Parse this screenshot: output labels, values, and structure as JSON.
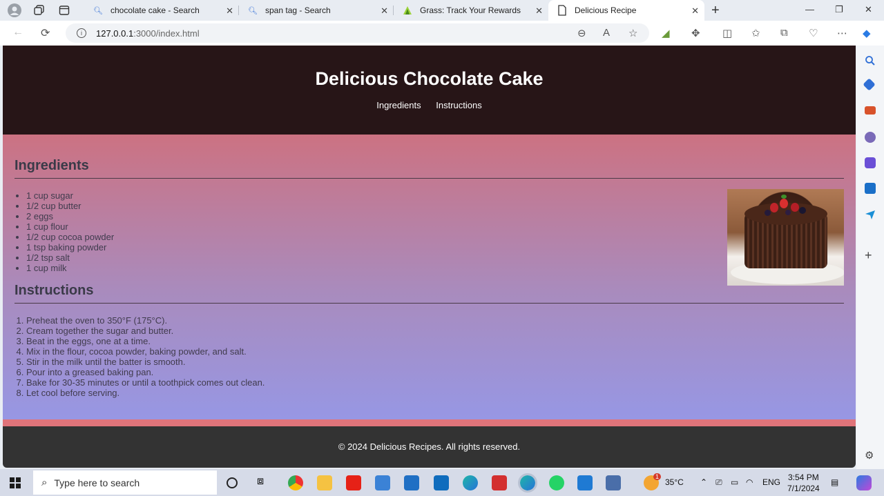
{
  "browser": {
    "tabs": [
      {
        "title": "chocolate cake - Search",
        "active": false
      },
      {
        "title": "span tag - Search",
        "active": false
      },
      {
        "title": "Grass: Track Your Rewards",
        "active": false
      },
      {
        "title": "Delicious Recipe",
        "active": true
      }
    ],
    "url_host": "127.0.0.1",
    "url_path": ":3000/index.html"
  },
  "page": {
    "title": "Delicious Chocolate Cake",
    "nav": [
      "Ingredients",
      "Instructions"
    ],
    "ingredients_heading": "Ingredients",
    "ingredients": [
      "1 cup sugar",
      "1/2 cup butter",
      "2 eggs",
      "1 cup flour",
      "1/2 cup cocoa powder",
      "1 tsp baking powder",
      "1/2 tsp salt",
      "1 cup milk"
    ],
    "instructions_heading": "Instructions",
    "instructions": [
      "Preheat the oven to 350°F (175°C).",
      "Cream together the sugar and butter.",
      "Beat in the eggs, one at a time.",
      "Mix in the flour, cocoa powder, baking powder, and salt.",
      "Stir in the milk until the batter is smooth.",
      "Pour into a greased baking pan.",
      "Bake for 30-35 minutes or until a toothpick comes out clean.",
      "Let cool before serving."
    ],
    "footer": "© 2024 Delicious Recipes. All rights reserved.",
    "colors": {
      "header_bg": "#271517",
      "footer_bg": "#333333",
      "gradient_top": "#cc7282",
      "gradient_bottom": "#9797e4",
      "accent_strip": "#e0747a"
    }
  },
  "taskbar": {
    "search_placeholder": "Type here to search",
    "weather": "35°C",
    "weather_badge": "1",
    "language": "ENG",
    "time": "3:54 PM",
    "date": "7/1/2024"
  }
}
